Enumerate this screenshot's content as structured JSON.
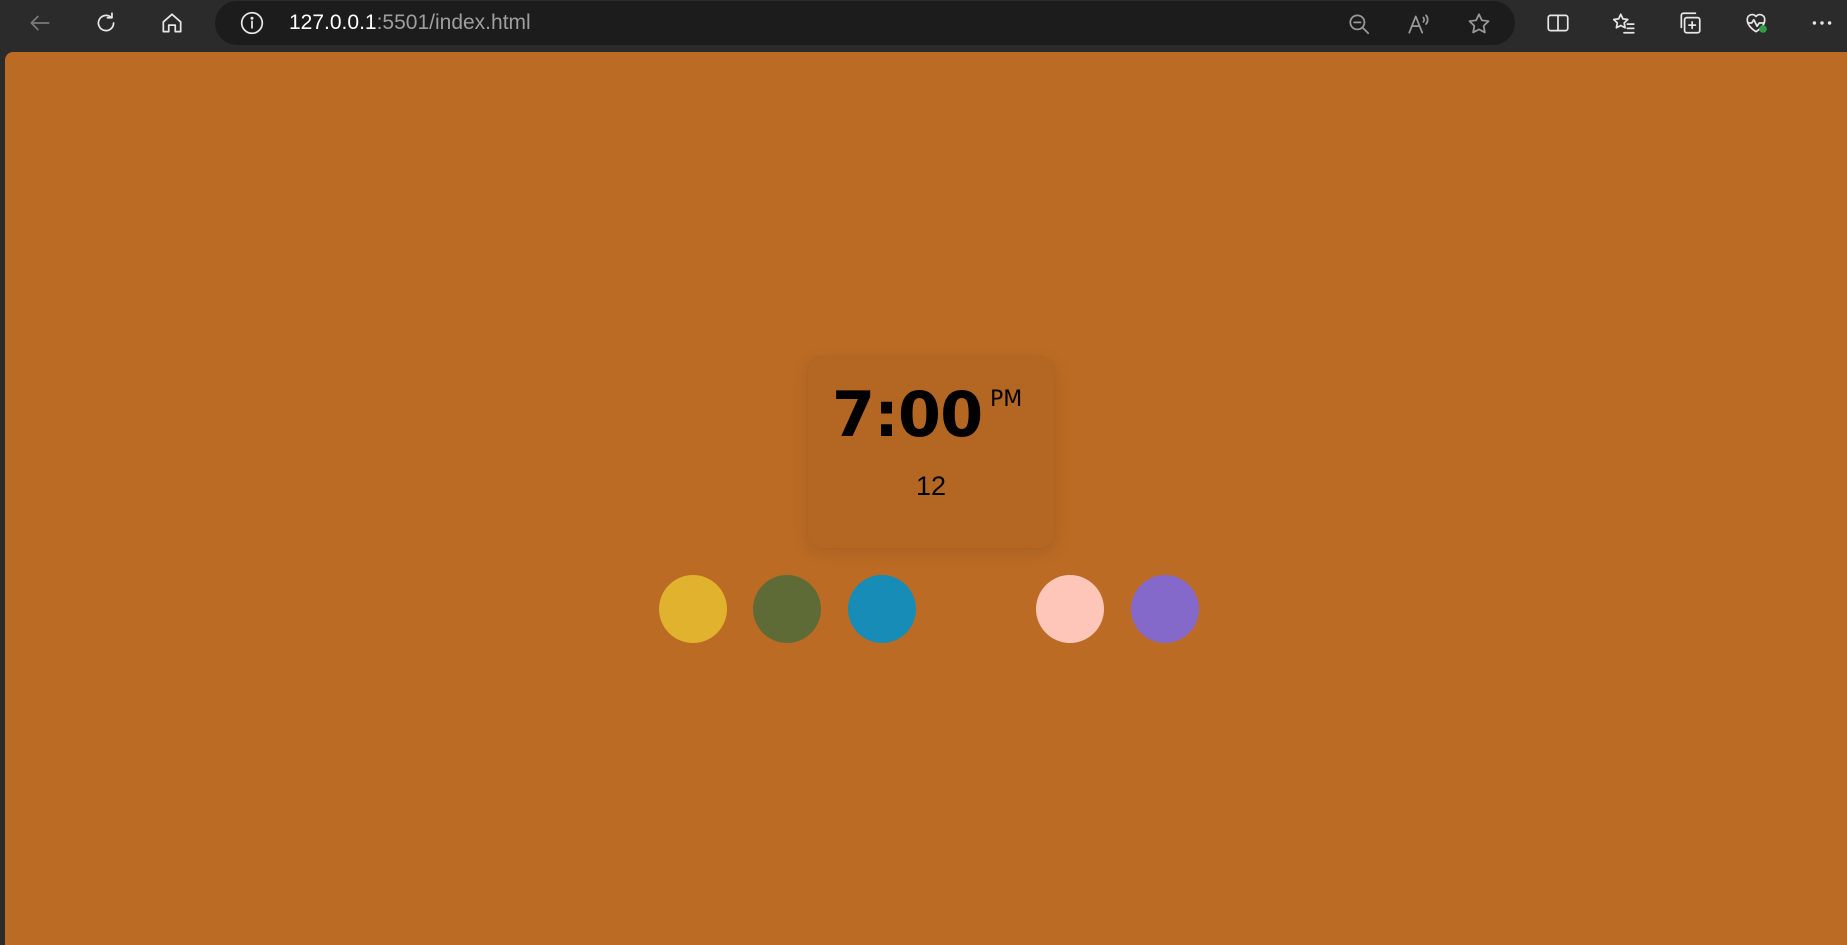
{
  "browser": {
    "url_host": "127.0.0.1",
    "url_rest": ":5501/index.html",
    "icons": {
      "back": "back-arrow-icon",
      "reload": "reload-icon",
      "home": "home-icon",
      "site_info": "info-icon",
      "zoom": "zoom-out-icon",
      "read_aloud": "read-aloud-icon",
      "favorite": "star-icon",
      "split_screen": "split-screen-icon",
      "favorites": "favorites-list-icon",
      "collections": "collections-icon",
      "health": "browser-essentials-icon",
      "menu": "more-icon"
    }
  },
  "page": {
    "background_color": "#bb6b24",
    "clock": {
      "time": "7:00",
      "ampm": "PM",
      "sub": "12"
    },
    "theme_swatches": [
      {
        "name": "yellow",
        "color": "#e1b22d"
      },
      {
        "name": "olive",
        "color": "#5f6b36"
      },
      {
        "name": "blue",
        "color": "#178cb6"
      },
      {
        "name": "orange",
        "color": "#bb6b24"
      },
      {
        "name": "peach",
        "color": "#fec6b9"
      },
      {
        "name": "purple",
        "color": "#8469ca"
      }
    ]
  }
}
